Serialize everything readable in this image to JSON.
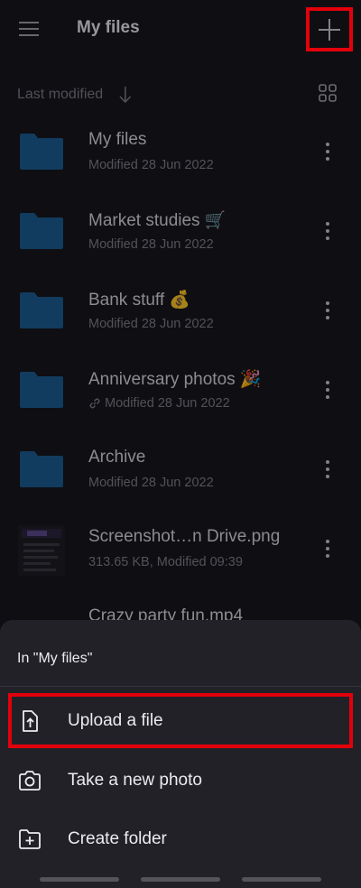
{
  "appbar": {
    "title": "My files",
    "menu_icon": "hamburger-icon",
    "add_icon": "plus-icon"
  },
  "sort": {
    "label": "Last modified",
    "direction_icon": "arrow-down-icon",
    "view_toggle_icon": "grid-view-icon"
  },
  "files": [
    {
      "name": "My files",
      "meta": "Modified 28 Jun 2022",
      "type": "folder",
      "shared": false
    },
    {
      "name": "Market studies 🛒",
      "meta": "Modified 28 Jun 2022",
      "type": "folder",
      "shared": false
    },
    {
      "name": "Bank stuff 💰",
      "meta": "Modified 28 Jun 2022",
      "type": "folder",
      "shared": false
    },
    {
      "name": "Anniversary photos 🎉",
      "meta": "Modified 28 Jun 2022",
      "type": "folder",
      "shared": true
    },
    {
      "name": "Archive",
      "meta": "Modified 28 Jun 2022",
      "type": "folder",
      "shared": false
    },
    {
      "name": "Screenshot…n Drive.png",
      "meta": "313.65 KB, Modified 09:39",
      "type": "image",
      "shared": false
    },
    {
      "name": "Crazy party fun.mp4",
      "meta": "",
      "type": "video",
      "shared": false
    }
  ],
  "sheet": {
    "title": "In \"My files\"",
    "actions": [
      {
        "label": "Upload a file",
        "icon": "upload-file-icon"
      },
      {
        "label": "Take a new photo",
        "icon": "camera-icon"
      },
      {
        "label": "Create folder",
        "icon": "create-folder-icon"
      }
    ]
  },
  "colors": {
    "background": "#17161c",
    "folder": "#1b5d93",
    "sheet": "#222128",
    "highlight": "#e3000b"
  }
}
